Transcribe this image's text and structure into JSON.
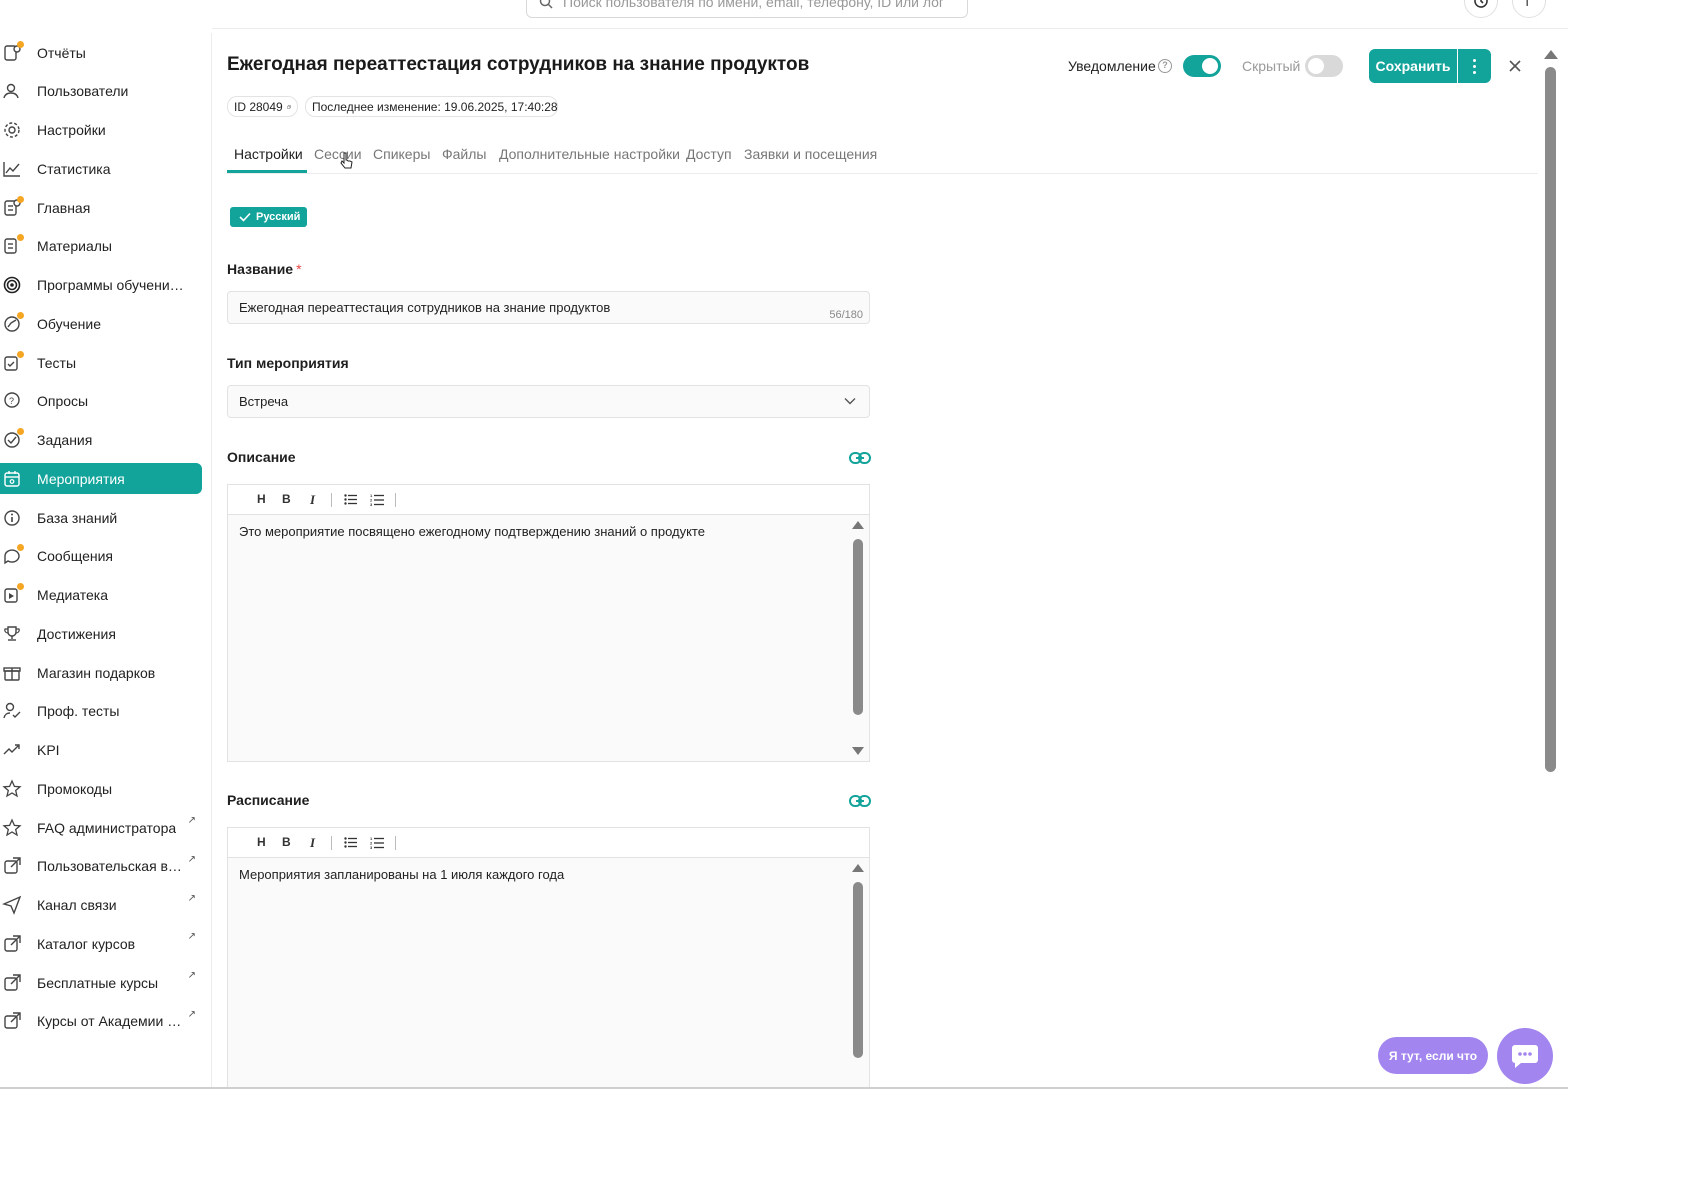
{
  "search": {
    "placeholder": "Поиск пользователя по имени, email, телефону, ID или логину"
  },
  "header": {
    "profile_initial": "Г"
  },
  "sidebar": {
    "items": [
      {
        "label": "Отчёты",
        "icon": "reports-icon"
      },
      {
        "label": "Пользователи",
        "icon": "users-icon"
      },
      {
        "label": "Настройки",
        "icon": "gear-icon"
      },
      {
        "label": "Статистика",
        "icon": "chart-line-icon"
      },
      {
        "label": "Главная",
        "icon": "home-doc-icon"
      },
      {
        "label": "Материалы",
        "icon": "materials-icon"
      },
      {
        "label": "Программы обучения п...",
        "icon": "programs-icon"
      },
      {
        "label": "Обучение",
        "icon": "learning-icon"
      },
      {
        "label": "Тесты",
        "icon": "tests-icon"
      },
      {
        "label": "Опросы",
        "icon": "surveys-icon"
      },
      {
        "label": "Задания",
        "icon": "tasks-icon"
      },
      {
        "label": "Мероприятия",
        "icon": "calendar-icon",
        "active": true
      },
      {
        "label": "База знаний",
        "icon": "info-icon"
      },
      {
        "label": "Сообщения",
        "icon": "chat-icon"
      },
      {
        "label": "Медиатека",
        "icon": "media-icon"
      },
      {
        "label": "Достижения",
        "icon": "trophy-icon"
      },
      {
        "label": "Магазин подарков",
        "icon": "gift-icon"
      },
      {
        "label": "Проф. тесты",
        "icon": "prof-test-icon"
      },
      {
        "label": "KPI",
        "icon": "trend-icon"
      },
      {
        "label": "Промокоды",
        "icon": "star-icon"
      },
      {
        "label": "FAQ администратора",
        "icon": "star-icon",
        "external": true
      },
      {
        "label": "Пользовательская веб-...",
        "icon": "external-link-icon",
        "external": true
      },
      {
        "label": "Канал связи",
        "icon": "send-icon",
        "external": true
      },
      {
        "label": "Каталог курсов",
        "icon": "external-link-icon",
        "external": true
      },
      {
        "label": "Бесплатные курсы",
        "icon": "external-link-icon",
        "external": true
      },
      {
        "label": "Курсы от Академии Экв...",
        "icon": "external-link-icon",
        "external": true
      }
    ]
  },
  "page": {
    "title": "Ежегодная переаттестация сотрудников на знание продуктов",
    "notification_label": "Уведомление",
    "notification_on": true,
    "hidden_label": "Скрытый",
    "hidden_on": false,
    "save_label": "Сохранить",
    "id_label": "ID 28049",
    "last_modified": "Последнее изменение: 19.06.2025, 17:40:28"
  },
  "tabs": [
    "Настройки",
    "Сессии",
    "Спикеры",
    "Файлы",
    "Дополнительные настройки",
    "Доступ",
    "Заявки и посещения"
  ],
  "active_tab": "Настройки",
  "language_badge": "Русский",
  "form": {
    "name_label": "Название",
    "name_value": "Ежегодная переаттестация сотрудников на знание продуктов",
    "name_counter": "56/180",
    "type_label": "Тип мероприятия",
    "type_value": "Встреча",
    "description_label": "Описание",
    "description_text": "Это мероприятие посвящено ежегодному подтверждению знаний о продукте",
    "schedule_label": "Расписание",
    "schedule_text": "Мероприятия запланированы на 1 июля каждого года"
  },
  "toolbar": {
    "heading": "H",
    "bold": "B",
    "italic": "I"
  },
  "helper": {
    "label": "Я тут, если что"
  },
  "colors": {
    "accent": "#12a39a",
    "helper": "#a285ee",
    "required": "#e54545"
  }
}
